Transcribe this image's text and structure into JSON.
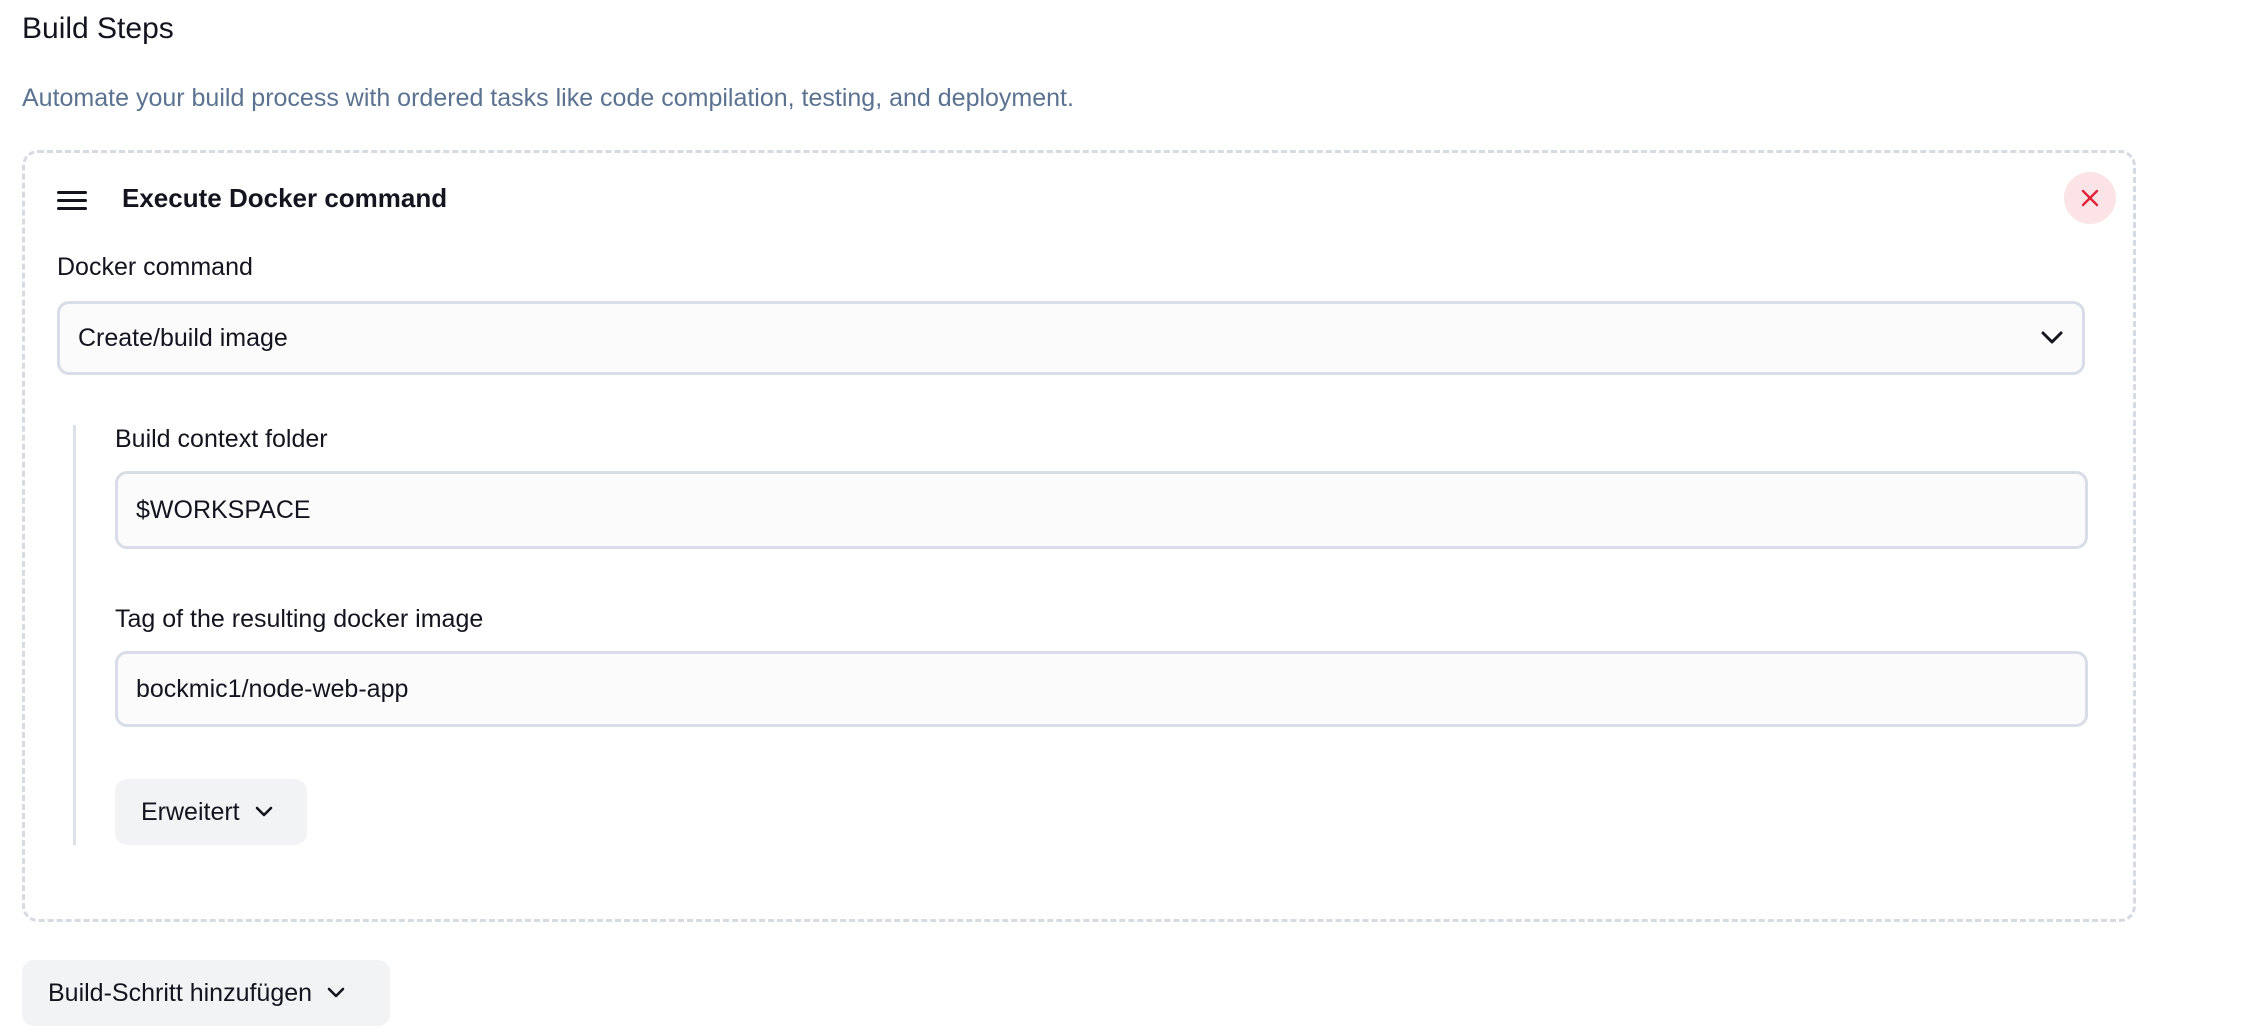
{
  "section": {
    "title": "Build Steps",
    "description": "Automate your build process with ordered tasks like code compilation, testing, and deployment."
  },
  "step": {
    "title": "Execute Docker command",
    "close_icon": "close-icon",
    "drag_icon": "drag-handle-icon",
    "docker_command": {
      "label": "Docker command",
      "selected": "Create/build image"
    },
    "build_context": {
      "label": "Build context folder",
      "value": "$WORKSPACE"
    },
    "image_tag": {
      "label": "Tag of the resulting docker image",
      "value": "bockmic1/node-web-app"
    },
    "advanced_label": "Erweitert"
  },
  "add_step_label": "Build-Schritt hinzufügen",
  "colors": {
    "accent_danger": "#e0243a",
    "danger_bg": "#fbe3e6",
    "muted_text": "#5b7391"
  }
}
